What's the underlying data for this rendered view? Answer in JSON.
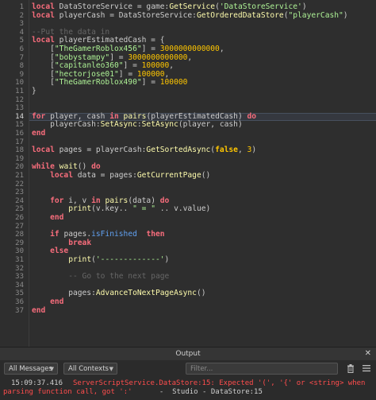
{
  "editor": {
    "current_line": 14,
    "lines": [
      {
        "n": 1,
        "tokens": [
          [
            "kw",
            "local"
          ],
          [
            "pl",
            " DataStoreService = "
          ],
          [
            "pl",
            "game:"
          ],
          [
            "fn",
            "GetService"
          ],
          [
            "pl",
            "("
          ],
          [
            "str",
            "'DataStoreService'"
          ],
          [
            "pl",
            ")"
          ]
        ]
      },
      {
        "n": 2,
        "tokens": [
          [
            "kw",
            "local"
          ],
          [
            "pl",
            " playerCash = DataStoreService:"
          ],
          [
            "fn",
            "GetOrderedDataStore"
          ],
          [
            "pl",
            "("
          ],
          [
            "str",
            "\"playerCash\""
          ],
          [
            "pl",
            ")"
          ]
        ]
      },
      {
        "n": 3,
        "tokens": []
      },
      {
        "n": 4,
        "tokens": [
          [
            "cm",
            "--Put the data in"
          ]
        ]
      },
      {
        "n": 5,
        "tokens": [
          [
            "kw",
            "local"
          ],
          [
            "pl",
            " playerEstimatedCash = {"
          ]
        ]
      },
      {
        "n": 6,
        "tokens": [
          [
            "pl",
            "    ["
          ],
          [
            "str",
            "\"TheGamerRoblox456\""
          ],
          [
            "pl",
            "] = "
          ],
          [
            "num",
            "3000000000000"
          ],
          [
            "pl",
            ","
          ]
        ]
      },
      {
        "n": 7,
        "tokens": [
          [
            "pl",
            "    ["
          ],
          [
            "str",
            "\"bobystampy\""
          ],
          [
            "pl",
            "] = "
          ],
          [
            "num",
            "3000000000000"
          ],
          [
            "pl",
            ","
          ]
        ]
      },
      {
        "n": 8,
        "tokens": [
          [
            "pl",
            "    ["
          ],
          [
            "str",
            "\"capitanleo360\""
          ],
          [
            "pl",
            "] = "
          ],
          [
            "num",
            "100000"
          ],
          [
            "pl",
            ","
          ]
        ]
      },
      {
        "n": 9,
        "tokens": [
          [
            "pl",
            "    ["
          ],
          [
            "str",
            "\"hectorjose01\""
          ],
          [
            "pl",
            "] = "
          ],
          [
            "num",
            "100000"
          ],
          [
            "pl",
            ","
          ]
        ]
      },
      {
        "n": 10,
        "tokens": [
          [
            "pl",
            "    ["
          ],
          [
            "str",
            "\"TheGamerRoblox490\""
          ],
          [
            "pl",
            "] = "
          ],
          [
            "num",
            "100000"
          ]
        ]
      },
      {
        "n": 11,
        "tokens": [
          [
            "pl",
            "}"
          ]
        ]
      },
      {
        "n": 12,
        "tokens": []
      },
      {
        "n": 13,
        "tokens": []
      },
      {
        "n": 14,
        "tokens": [
          [
            "kw",
            "for"
          ],
          [
            "pl",
            " player, cash "
          ],
          [
            "kw",
            "in"
          ],
          [
            "pl",
            " "
          ],
          [
            "fn",
            "pairs"
          ],
          [
            "pl",
            "(playerEstimatedCash) "
          ],
          [
            "kw",
            "do"
          ]
        ]
      },
      {
        "n": 15,
        "tokens": [
          [
            "pl",
            "    playerCash:"
          ],
          [
            "fn",
            "SetAsync"
          ],
          [
            "pl",
            ":"
          ],
          [
            "fn",
            "SetAsync"
          ],
          [
            "pl",
            "(player, cash)"
          ]
        ]
      },
      {
        "n": 16,
        "tokens": [
          [
            "kw",
            "end"
          ]
        ]
      },
      {
        "n": 17,
        "tokens": []
      },
      {
        "n": 18,
        "tokens": [
          [
            "kw",
            "local"
          ],
          [
            "pl",
            " pages = playerCash:"
          ],
          [
            "fn",
            "GetSortedAsync"
          ],
          [
            "pl",
            "("
          ],
          [
            "bool",
            "false"
          ],
          [
            "pl",
            ", "
          ],
          [
            "num",
            "3"
          ],
          [
            "pl",
            ")"
          ]
        ]
      },
      {
        "n": 19,
        "tokens": []
      },
      {
        "n": 20,
        "tokens": [
          [
            "kw",
            "while"
          ],
          [
            "pl",
            " "
          ],
          [
            "fn",
            "wait"
          ],
          [
            "pl",
            "() "
          ],
          [
            "kw",
            "do"
          ]
        ]
      },
      {
        "n": 21,
        "tokens": [
          [
            "pl",
            "    "
          ],
          [
            "kw",
            "local"
          ],
          [
            "pl",
            " data = pages:"
          ],
          [
            "fn",
            "GetCurrentPage"
          ],
          [
            "pl",
            "()"
          ]
        ]
      },
      {
        "n": 22,
        "tokens": []
      },
      {
        "n": 23,
        "tokens": []
      },
      {
        "n": 24,
        "tokens": [
          [
            "pl",
            "    "
          ],
          [
            "kw",
            "for"
          ],
          [
            "pl",
            " i, v "
          ],
          [
            "kw",
            "in"
          ],
          [
            "pl",
            " "
          ],
          [
            "fn",
            "pairs"
          ],
          [
            "pl",
            "(data) "
          ],
          [
            "kw",
            "do"
          ]
        ]
      },
      {
        "n": 25,
        "tokens": [
          [
            "pl",
            "        "
          ],
          [
            "fn",
            "print"
          ],
          [
            "pl",
            "(v.key.. "
          ],
          [
            "str",
            "\" = \""
          ],
          [
            "pl",
            " .. v.value)"
          ]
        ]
      },
      {
        "n": 26,
        "tokens": [
          [
            "pl",
            "    "
          ],
          [
            "kw",
            "end"
          ]
        ]
      },
      {
        "n": 27,
        "tokens": []
      },
      {
        "n": 28,
        "tokens": [
          [
            "pl",
            "    "
          ],
          [
            "kw",
            "if"
          ],
          [
            "pl",
            " pages."
          ],
          [
            "pr",
            "isFinished"
          ],
          [
            "pl",
            "  "
          ],
          [
            "kw",
            "then"
          ]
        ]
      },
      {
        "n": 29,
        "tokens": [
          [
            "pl",
            "        "
          ],
          [
            "kw",
            "break"
          ]
        ]
      },
      {
        "n": 30,
        "tokens": [
          [
            "pl",
            "    "
          ],
          [
            "kw",
            "else"
          ]
        ]
      },
      {
        "n": 31,
        "tokens": [
          [
            "pl",
            "        "
          ],
          [
            "fn",
            "print"
          ],
          [
            "pl",
            "("
          ],
          [
            "str",
            "'-------------'"
          ],
          [
            "pl",
            ")"
          ]
        ]
      },
      {
        "n": 32,
        "tokens": []
      },
      {
        "n": 33,
        "tokens": [
          [
            "pl",
            "        "
          ],
          [
            "cm",
            "-- Go to the next page"
          ]
        ]
      },
      {
        "n": 34,
        "tokens": []
      },
      {
        "n": 35,
        "tokens": [
          [
            "pl",
            "        pages:"
          ],
          [
            "fn",
            "AdvanceToNextPageAsync"
          ],
          [
            "pl",
            "()"
          ]
        ]
      },
      {
        "n": 36,
        "tokens": [
          [
            "pl",
            "    "
          ],
          [
            "kw",
            "end"
          ]
        ]
      },
      {
        "n": 37,
        "tokens": [
          [
            "kw",
            "end"
          ]
        ]
      }
    ]
  },
  "output": {
    "title": "Output",
    "close_glyph": "✕",
    "messages_filter": "All Messages",
    "contexts_filter": "All Contexts",
    "filter_placeholder": "Filter...",
    "trash_icon": "trash-icon",
    "menu_icon": "menu-icon",
    "log": {
      "time": "15:09:37.416",
      "error_text": "ServerScriptService.DataStore:15: Expected '(', '{' or <string> when",
      "error_text_2": "parsing function call, got ':'",
      "source": "  -  Studio - DataStore:15"
    }
  },
  "colors": {
    "background": "#2e2e2e",
    "keyword": "#f86d7c",
    "function": "#fdfbac",
    "string": "#adf195",
    "number": "#ffc600",
    "comment": "#666666",
    "error": "#ff4d4d"
  }
}
